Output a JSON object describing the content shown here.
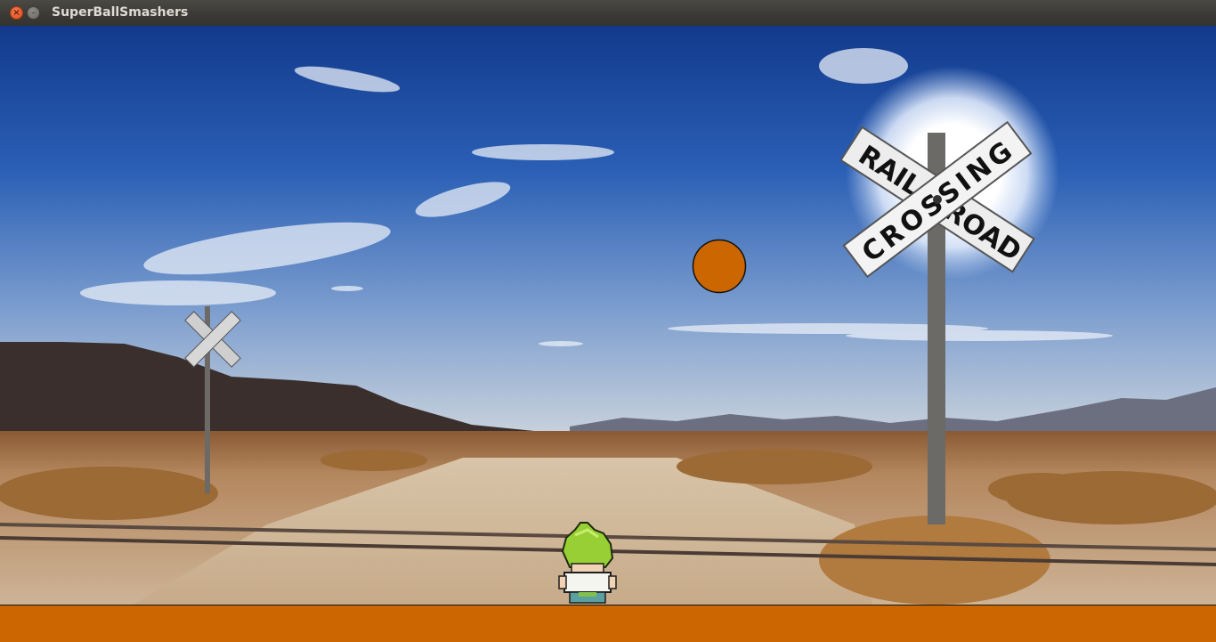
{
  "window": {
    "title": "SuperBallSmashers",
    "close_glyph": "×",
    "minimize_glyph": "–"
  },
  "sign": {
    "rail": "RAIL",
    "road": "ROAD",
    "crossing": "CROSSING"
  },
  "colors": {
    "ball": "#cc6600",
    "ground_bar": "#cc6600"
  },
  "icons": {
    "close": "close-icon",
    "minimize": "minimize-icon"
  }
}
